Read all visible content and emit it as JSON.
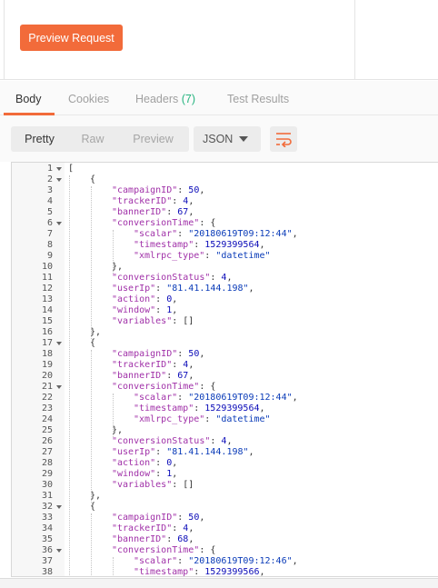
{
  "request": {
    "preview_button": "Preview Request"
  },
  "tabs": [
    {
      "label": "Body"
    },
    {
      "label": "Cookies"
    },
    {
      "label": "Headers",
      "count": "(7)"
    },
    {
      "label": "Test Results"
    }
  ],
  "view_modes": [
    "Pretty",
    "Raw",
    "Preview"
  ],
  "format": {
    "selected": "JSON"
  },
  "colors": {
    "accent": "#f26b3a",
    "count": "#26b47f"
  },
  "code_lines": [
    {
      "n": "1",
      "fold": true,
      "indent": 0,
      "parts": [
        [
          "p",
          "["
        ]
      ]
    },
    {
      "n": "2",
      "fold": true,
      "indent": 1,
      "parts": [
        [
          "p",
          "{"
        ]
      ]
    },
    {
      "n": "3",
      "indent": 2,
      "parts": [
        [
          "k",
          "\"campaignID\""
        ],
        [
          "p",
          ": "
        ],
        [
          "n",
          "50"
        ],
        [
          "p",
          ","
        ]
      ]
    },
    {
      "n": "4",
      "indent": 2,
      "parts": [
        [
          "k",
          "\"trackerID\""
        ],
        [
          "p",
          ": "
        ],
        [
          "n",
          "4"
        ],
        [
          "p",
          ","
        ]
      ]
    },
    {
      "n": "5",
      "indent": 2,
      "parts": [
        [
          "k",
          "\"bannerID\""
        ],
        [
          "p",
          ": "
        ],
        [
          "n",
          "67"
        ],
        [
          "p",
          ","
        ]
      ]
    },
    {
      "n": "6",
      "fold": true,
      "indent": 2,
      "parts": [
        [
          "k",
          "\"conversionTime\""
        ],
        [
          "p",
          ": {"
        ]
      ]
    },
    {
      "n": "7",
      "indent": 3,
      "parts": [
        [
          "k",
          "\"scalar\""
        ],
        [
          "p",
          ": "
        ],
        [
          "s",
          "\"20180619T09:12:44\""
        ],
        [
          "p",
          ","
        ]
      ]
    },
    {
      "n": "8",
      "indent": 3,
      "parts": [
        [
          "k",
          "\"timestamp\""
        ],
        [
          "p",
          ": "
        ],
        [
          "n",
          "1529399564"
        ],
        [
          "p",
          ","
        ]
      ]
    },
    {
      "n": "9",
      "indent": 3,
      "parts": [
        [
          "k",
          "\"xmlrpc_type\""
        ],
        [
          "p",
          ": "
        ],
        [
          "s",
          "\"datetime\""
        ]
      ]
    },
    {
      "n": "10",
      "indent": 2,
      "parts": [
        [
          "p",
          "},"
        ]
      ]
    },
    {
      "n": "11",
      "indent": 2,
      "parts": [
        [
          "k",
          "\"conversionStatus\""
        ],
        [
          "p",
          ": "
        ],
        [
          "n",
          "4"
        ],
        [
          "p",
          ","
        ]
      ]
    },
    {
      "n": "12",
      "indent": 2,
      "parts": [
        [
          "k",
          "\"userIp\""
        ],
        [
          "p",
          ": "
        ],
        [
          "s",
          "\"81.41.144.198\""
        ],
        [
          "p",
          ","
        ]
      ]
    },
    {
      "n": "13",
      "indent": 2,
      "parts": [
        [
          "k",
          "\"action\""
        ],
        [
          "p",
          ": "
        ],
        [
          "n",
          "0"
        ],
        [
          "p",
          ","
        ]
      ]
    },
    {
      "n": "14",
      "indent": 2,
      "parts": [
        [
          "k",
          "\"window\""
        ],
        [
          "p",
          ": "
        ],
        [
          "n",
          "1"
        ],
        [
          "p",
          ","
        ]
      ]
    },
    {
      "n": "15",
      "indent": 2,
      "parts": [
        [
          "k",
          "\"variables\""
        ],
        [
          "p",
          ": []"
        ]
      ]
    },
    {
      "n": "16",
      "indent": 1,
      "parts": [
        [
          "p",
          "},"
        ]
      ]
    },
    {
      "n": "17",
      "fold": true,
      "indent": 1,
      "parts": [
        [
          "p",
          "{"
        ]
      ]
    },
    {
      "n": "18",
      "indent": 2,
      "parts": [
        [
          "k",
          "\"campaignID\""
        ],
        [
          "p",
          ": "
        ],
        [
          "n",
          "50"
        ],
        [
          "p",
          ","
        ]
      ]
    },
    {
      "n": "19",
      "indent": 2,
      "parts": [
        [
          "k",
          "\"trackerID\""
        ],
        [
          "p",
          ": "
        ],
        [
          "n",
          "4"
        ],
        [
          "p",
          ","
        ]
      ]
    },
    {
      "n": "20",
      "indent": 2,
      "parts": [
        [
          "k",
          "\"bannerID\""
        ],
        [
          "p",
          ": "
        ],
        [
          "n",
          "67"
        ],
        [
          "p",
          ","
        ]
      ]
    },
    {
      "n": "21",
      "fold": true,
      "indent": 2,
      "parts": [
        [
          "k",
          "\"conversionTime\""
        ],
        [
          "p",
          ": {"
        ]
      ]
    },
    {
      "n": "22",
      "indent": 3,
      "parts": [
        [
          "k",
          "\"scalar\""
        ],
        [
          "p",
          ": "
        ],
        [
          "s",
          "\"20180619T09:12:44\""
        ],
        [
          "p",
          ","
        ]
      ]
    },
    {
      "n": "23",
      "indent": 3,
      "parts": [
        [
          "k",
          "\"timestamp\""
        ],
        [
          "p",
          ": "
        ],
        [
          "n",
          "1529399564"
        ],
        [
          "p",
          ","
        ]
      ]
    },
    {
      "n": "24",
      "indent": 3,
      "parts": [
        [
          "k",
          "\"xmlrpc_type\""
        ],
        [
          "p",
          ": "
        ],
        [
          "s",
          "\"datetime\""
        ]
      ]
    },
    {
      "n": "25",
      "indent": 2,
      "parts": [
        [
          "p",
          "},"
        ]
      ]
    },
    {
      "n": "26",
      "indent": 2,
      "parts": [
        [
          "k",
          "\"conversionStatus\""
        ],
        [
          "p",
          ": "
        ],
        [
          "n",
          "4"
        ],
        [
          "p",
          ","
        ]
      ]
    },
    {
      "n": "27",
      "indent": 2,
      "parts": [
        [
          "k",
          "\"userIp\""
        ],
        [
          "p",
          ": "
        ],
        [
          "s",
          "\"81.41.144.198\""
        ],
        [
          "p",
          ","
        ]
      ]
    },
    {
      "n": "28",
      "indent": 2,
      "parts": [
        [
          "k",
          "\"action\""
        ],
        [
          "p",
          ": "
        ],
        [
          "n",
          "0"
        ],
        [
          "p",
          ","
        ]
      ]
    },
    {
      "n": "29",
      "indent": 2,
      "parts": [
        [
          "k",
          "\"window\""
        ],
        [
          "p",
          ": "
        ],
        [
          "n",
          "1"
        ],
        [
          "p",
          ","
        ]
      ]
    },
    {
      "n": "30",
      "indent": 2,
      "parts": [
        [
          "k",
          "\"variables\""
        ],
        [
          "p",
          ": []"
        ]
      ]
    },
    {
      "n": "31",
      "indent": 1,
      "parts": [
        [
          "p",
          "},"
        ]
      ]
    },
    {
      "n": "32",
      "fold": true,
      "indent": 1,
      "parts": [
        [
          "p",
          "{"
        ]
      ]
    },
    {
      "n": "33",
      "indent": 2,
      "parts": [
        [
          "k",
          "\"campaignID\""
        ],
        [
          "p",
          ": "
        ],
        [
          "n",
          "50"
        ],
        [
          "p",
          ","
        ]
      ]
    },
    {
      "n": "34",
      "indent": 2,
      "parts": [
        [
          "k",
          "\"trackerID\""
        ],
        [
          "p",
          ": "
        ],
        [
          "n",
          "4"
        ],
        [
          "p",
          ","
        ]
      ]
    },
    {
      "n": "35",
      "indent": 2,
      "parts": [
        [
          "k",
          "\"bannerID\""
        ],
        [
          "p",
          ": "
        ],
        [
          "n",
          "68"
        ],
        [
          "p",
          ","
        ]
      ]
    },
    {
      "n": "36",
      "fold": true,
      "indent": 2,
      "parts": [
        [
          "k",
          "\"conversionTime\""
        ],
        [
          "p",
          ": {"
        ]
      ]
    },
    {
      "n": "37",
      "indent": 3,
      "parts": [
        [
          "k",
          "\"scalar\""
        ],
        [
          "p",
          ": "
        ],
        [
          "s",
          "\"20180619T09:12:46\""
        ],
        [
          "p",
          ","
        ]
      ]
    },
    {
      "n": "38",
      "indent": 3,
      "parts": [
        [
          "k",
          "\"timestamp\""
        ],
        [
          "p",
          ": "
        ],
        [
          "n",
          "1529399566"
        ],
        [
          "p",
          ","
        ]
      ]
    }
  ]
}
